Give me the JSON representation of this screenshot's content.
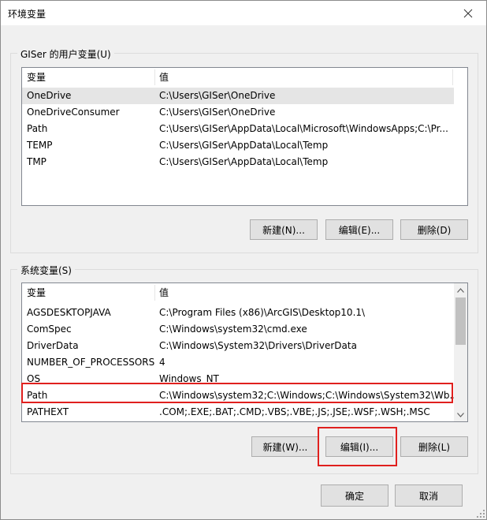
{
  "window": {
    "title": "环境变量"
  },
  "user_vars": {
    "group_label": "GISer 的用户变量(U)",
    "col_name": "变量",
    "col_value": "值",
    "rows": [
      {
        "name": "OneDrive",
        "value": "C:\\Users\\GISer\\OneDrive"
      },
      {
        "name": "OneDriveConsumer",
        "value": "C:\\Users\\GISer\\OneDrive"
      },
      {
        "name": "Path",
        "value": "C:\\Users\\GISer\\AppData\\Local\\Microsoft\\WindowsApps;C:\\Pr..."
      },
      {
        "name": "TEMP",
        "value": "C:\\Users\\GISer\\AppData\\Local\\Temp"
      },
      {
        "name": "TMP",
        "value": "C:\\Users\\GISer\\AppData\\Local\\Temp"
      }
    ],
    "new_label": "新建(N)...",
    "edit_label": "编辑(E)...",
    "delete_label": "删除(D)"
  },
  "system_vars": {
    "group_label": "系统变量(S)",
    "col_name": "变量",
    "col_value": "值",
    "rows": [
      {
        "name": "AGSDESKTOPJAVA",
        "value": "C:\\Program Files (x86)\\ArcGIS\\Desktop10.1\\"
      },
      {
        "name": "ComSpec",
        "value": "C:\\Windows\\system32\\cmd.exe"
      },
      {
        "name": "DriverData",
        "value": "C:\\Windows\\System32\\Drivers\\DriverData"
      },
      {
        "name": "NUMBER_OF_PROCESSORS",
        "value": "4"
      },
      {
        "name": "OS",
        "value": "Windows_NT"
      },
      {
        "name": "Path",
        "value": "C:\\Windows\\system32;C:\\Windows;C:\\Windows\\System32\\Wb..."
      },
      {
        "name": "PATHEXT",
        "value": ".COM;.EXE;.BAT;.CMD;.VBS;.VBE;.JS;.JSE;.WSF;.WSH;.MSC"
      }
    ],
    "new_label": "新建(W)...",
    "edit_label": "编辑(I)...",
    "delete_label": "删除(L)"
  },
  "footer": {
    "ok_label": "确定",
    "cancel_label": "取消"
  },
  "colors": {
    "highlight": "#e0201e",
    "selected_row": "#e5e5e5"
  }
}
